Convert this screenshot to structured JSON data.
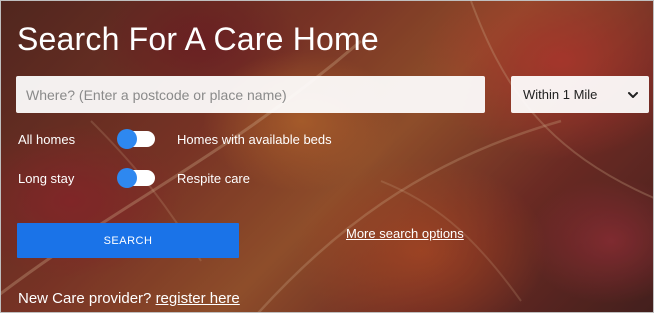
{
  "hero": {
    "title": "Search For A Care Home"
  },
  "search": {
    "placeholder": "Where? (Enter a postcode or place name)",
    "value": "",
    "distance": {
      "selected": "Within 1 Mile",
      "icon": "chevron-down-icon"
    }
  },
  "filters": [
    {
      "left_label": "All homes",
      "right_label": "Homes with available beds",
      "toggle_state": "left"
    },
    {
      "left_label": "Long stay",
      "right_label": "Respite care",
      "toggle_state": "left"
    }
  ],
  "actions": {
    "search_label": "SEARCH",
    "more_options_label": "More search options"
  },
  "footer": {
    "prompt": "New Care provider?",
    "register_link": "register here"
  },
  "colors": {
    "accent": "#1a73e8",
    "toggle_knob": "#2e88f0",
    "text": "#ffffff"
  }
}
